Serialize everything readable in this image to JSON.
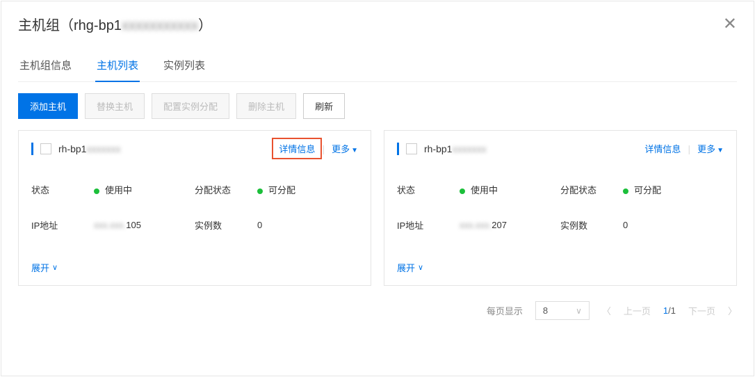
{
  "header": {
    "title_prefix": "主机组（rhg-bp1",
    "title_blur": "xxxxxxxxxxx",
    "title_suffix": "）"
  },
  "tabs": [
    "主机组信息",
    "主机列表",
    "实例列表"
  ],
  "active_tab": 1,
  "toolbar": {
    "add": "添加主机",
    "replace": "替换主机",
    "config": "配置实例分配",
    "delete": "删除主机",
    "refresh": "刷新"
  },
  "labels": {
    "status": "状态",
    "alloc_status": "分配状态",
    "ip": "IP地址",
    "instances": "实例数",
    "detail": "详情信息",
    "more": "更多",
    "expand": "展开",
    "per_page": "每页显示",
    "prev": "上一页",
    "next": "下一页"
  },
  "status_values": {
    "in_use": "使用中",
    "allocatable": "可分配"
  },
  "cards": [
    {
      "name_prefix": "rh-bp1",
      "name_blur": "xxxxxxx",
      "status": "in_use",
      "alloc": "allocatable",
      "ip_blur": "xxx.xxx.",
      "ip_suffix": "105",
      "instances": "0",
      "highlight_detail": true
    },
    {
      "name_prefix": "rh-bp1",
      "name_blur": "xxxxxxx",
      "status": "in_use",
      "alloc": "allocatable",
      "ip_blur": "xxx.xxx.",
      "ip_suffix": "207",
      "instances": "0",
      "highlight_detail": false
    }
  ],
  "pagination": {
    "page_size": "8",
    "current": "1",
    "total": "/1"
  }
}
